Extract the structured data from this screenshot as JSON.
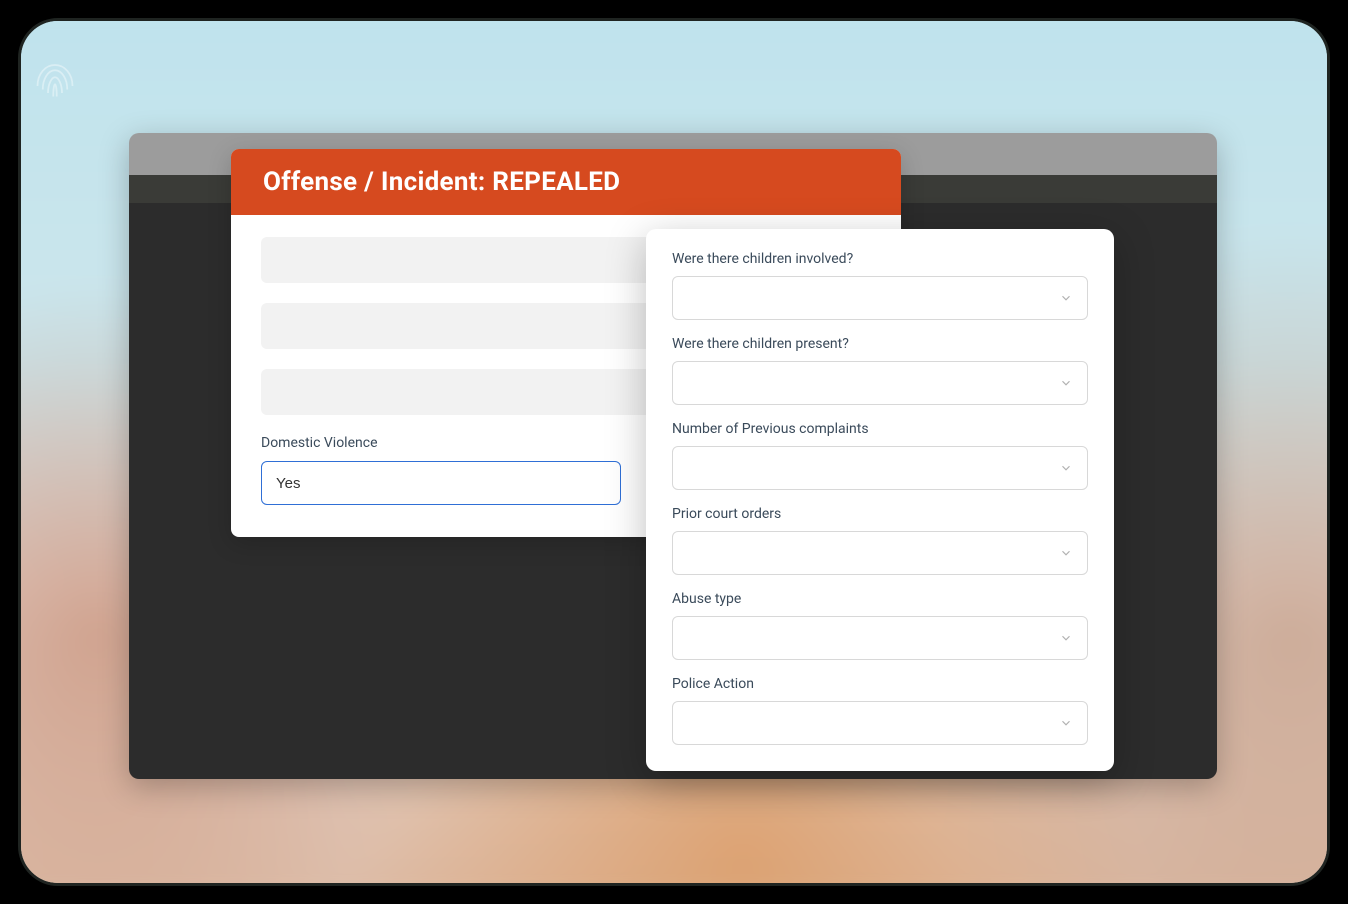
{
  "left_panel": {
    "title": "Offense / Incident: REPEALED",
    "domestic_violence": {
      "label": "Domestic Violence",
      "value": "Yes"
    }
  },
  "right_panel": {
    "fields": [
      {
        "label": "Were there children involved?",
        "value": ""
      },
      {
        "label": "Were there children present?",
        "value": ""
      },
      {
        "label": "Number of Previous complaints",
        "value": ""
      },
      {
        "label": "Prior court orders",
        "value": ""
      },
      {
        "label": "Abuse type",
        "value": ""
      },
      {
        "label": "Police Action",
        "value": ""
      }
    ]
  }
}
